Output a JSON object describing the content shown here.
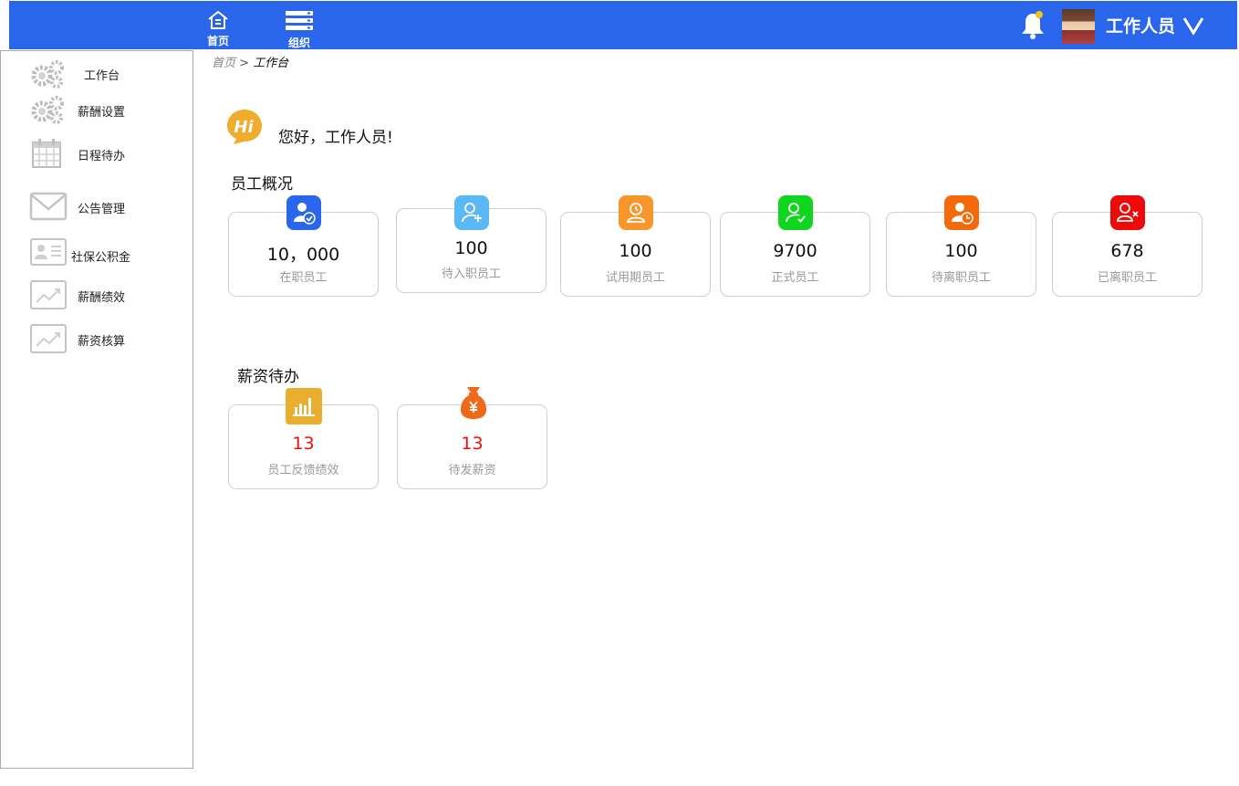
{
  "topbar": {
    "nav": [
      {
        "label": "首页",
        "icon": "home-icon"
      },
      {
        "label": "组织",
        "icon": "server-icon"
      }
    ],
    "user_name": "工作人员",
    "bell_icon": "bell-icon",
    "accent": "#2a66eb"
  },
  "sidebar": {
    "items": [
      {
        "label": "工作台",
        "icon": "gears-icon"
      },
      {
        "label": "薪酬设置",
        "icon": "gears-icon"
      },
      {
        "label": "日程待办",
        "icon": "calendar-icon"
      },
      {
        "label": "公告管理",
        "icon": "envelope-icon"
      },
      {
        "label": "社保公积金",
        "icon": "id-card-icon"
      },
      {
        "label": "薪酬绩效",
        "icon": "trend-chart-icon"
      },
      {
        "label": "薪资核算",
        "icon": "trend-chart-icon"
      }
    ]
  },
  "breadcrumb": {
    "home": "首页",
    "sep": ">",
    "current": "工作台"
  },
  "greeting": {
    "badge": "Hi",
    "text": "您好，工作人员!"
  },
  "overview": {
    "title": "员工概况",
    "cards": [
      {
        "value": "10，000",
        "label": "在职员工",
        "color": "#2a66eb"
      },
      {
        "value": "100",
        "label": "待入职员工",
        "color": "#5ab8f5"
      },
      {
        "value": "100",
        "label": "试用期员工",
        "color": "#f7962c"
      },
      {
        "value": "9700",
        "label": "正式员工",
        "color": "#11d620"
      },
      {
        "value": "100",
        "label": "待离职员工",
        "color": "#f46a0a"
      },
      {
        "value": "678",
        "label": "已离职员工",
        "color": "#ee0a0a"
      }
    ]
  },
  "payroll": {
    "title": "薪资待办",
    "cards": [
      {
        "value": "13",
        "label": "员工反馈绩效",
        "color": "#e9ae2e"
      },
      {
        "value": "13",
        "label": "待发薪资",
        "color": "#ee6a1a"
      }
    ]
  }
}
